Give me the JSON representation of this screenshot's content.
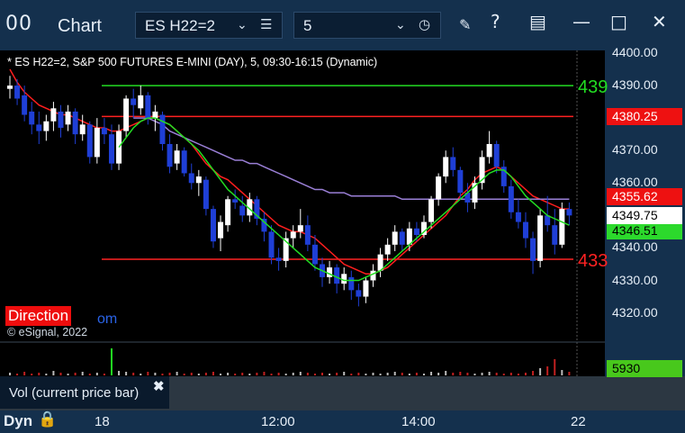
{
  "titlebar": {
    "icon": "00",
    "title": "Chart",
    "symbol": "ES H22=2",
    "interval": "5",
    "buttons": [
      "pencil-icon",
      "help-icon",
      "layout-icon",
      "minimize-icon",
      "maximize-icon",
      "close-icon"
    ]
  },
  "chart_title": "* ES H22=2, S&P 500 FUTURES E-MINI (DAY), 5, 09:30-16:15 (Dynamic)",
  "direction_label": "Direction",
  "direction_tail": "om",
  "copyright": "© eSignal, 2022",
  "vol_label": "Vol (current price bar)",
  "status": {
    "dyn": "Dyn"
  },
  "colors": {
    "up_candle": "#ffffff",
    "down_candle": "#1f3fd6",
    "red_line": "#ff1e1e",
    "green_line": "#22dd22",
    "purple_line": "#9a7fd6",
    "hline_red": "#ff2222",
    "hline_green": "#22dd22"
  },
  "chart_data": {
    "type": "candlestick",
    "symbol": "ES H22=2",
    "yrange": [
      4316,
      4400
    ],
    "y_ticks": [
      "4400.00",
      "4390.00",
      "4380.00",
      "4370.00",
      "4360.00",
      "4350.00",
      "4340.00",
      "4330.00",
      "4320.00"
    ],
    "x_ticks": [
      "18",
      "12:00",
      "14:00",
      "22"
    ],
    "horizontal_lines": [
      {
        "price": 4390,
        "color": "green",
        "label": "439"
      },
      {
        "price": 4380.5,
        "color": "red",
        "label": ""
      },
      {
        "price": 4336.5,
        "color": "red",
        "label": "433"
      }
    ],
    "price_tags": [
      {
        "price": 4380.25,
        "label": "4380.25",
        "style": "red"
      },
      {
        "price": 4355.62,
        "label": "4355.62",
        "style": "red"
      },
      {
        "price": 4349.75,
        "label": "4349.75",
        "style": "white"
      },
      {
        "price": 4346.51,
        "label": "4346.51",
        "style": "green"
      }
    ],
    "volume_tag": "5930",
    "candles": [
      {
        "o": 4389,
        "h": 4393,
        "l": 4386,
        "c": 4390
      },
      {
        "o": 4390,
        "h": 4392,
        "l": 4384,
        "c": 4386
      },
      {
        "o": 4387,
        "h": 4390,
        "l": 4379,
        "c": 4381
      },
      {
        "o": 4382,
        "h": 4385,
        "l": 4375,
        "c": 4378
      },
      {
        "o": 4378,
        "h": 4382,
        "l": 4372,
        "c": 4376
      },
      {
        "o": 4376,
        "h": 4381,
        "l": 4373,
        "c": 4379
      },
      {
        "o": 4379,
        "h": 4385,
        "l": 4376,
        "c": 4383
      },
      {
        "o": 4382,
        "h": 4384,
        "l": 4374,
        "c": 4377
      },
      {
        "o": 4378,
        "h": 4384,
        "l": 4376,
        "c": 4382
      },
      {
        "o": 4382,
        "h": 4383,
        "l": 4372,
        "c": 4375
      },
      {
        "o": 4375,
        "h": 4381,
        "l": 4373,
        "c": 4378
      },
      {
        "o": 4378,
        "h": 4379,
        "l": 4366,
        "c": 4368
      },
      {
        "o": 4368,
        "h": 4380,
        "l": 4366,
        "c": 4377
      },
      {
        "o": 4377,
        "h": 4380,
        "l": 4372,
        "c": 4375
      },
      {
        "o": 4375,
        "h": 4378,
        "l": 4364,
        "c": 4366
      },
      {
        "o": 4366,
        "h": 4378,
        "l": 4364,
        "c": 4376
      },
      {
        "o": 4376,
        "h": 4387,
        "l": 4374,
        "c": 4386
      },
      {
        "o": 4386,
        "h": 4389,
        "l": 4380,
        "c": 4384
      },
      {
        "o": 4383,
        "h": 4390,
        "l": 4381,
        "c": 4387
      },
      {
        "o": 4387,
        "h": 4388,
        "l": 4378,
        "c": 4380
      },
      {
        "o": 4380,
        "h": 4384,
        "l": 4376,
        "c": 4382
      },
      {
        "o": 4381,
        "h": 4382,
        "l": 4370,
        "c": 4372
      },
      {
        "o": 4372,
        "h": 4375,
        "l": 4363,
        "c": 4365
      },
      {
        "o": 4366,
        "h": 4372,
        "l": 4364,
        "c": 4370
      },
      {
        "o": 4370,
        "h": 4371,
        "l": 4362,
        "c": 4363
      },
      {
        "o": 4363,
        "h": 4366,
        "l": 4358,
        "c": 4360
      },
      {
        "o": 4360,
        "h": 4364,
        "l": 4356,
        "c": 4362
      },
      {
        "o": 4361,
        "h": 4362,
        "l": 4350,
        "c": 4352
      },
      {
        "o": 4352,
        "h": 4353,
        "l": 4340,
        "c": 4342
      },
      {
        "o": 4343,
        "h": 4350,
        "l": 4339,
        "c": 4348
      },
      {
        "o": 4347,
        "h": 4356,
        "l": 4345,
        "c": 4355
      },
      {
        "o": 4355,
        "h": 4358,
        "l": 4352,
        "c": 4354
      },
      {
        "o": 4353,
        "h": 4356,
        "l": 4348,
        "c": 4350
      },
      {
        "o": 4350,
        "h": 4357,
        "l": 4348,
        "c": 4355
      },
      {
        "o": 4355,
        "h": 4356,
        "l": 4347,
        "c": 4349
      },
      {
        "o": 4349,
        "h": 4351,
        "l": 4342,
        "c": 4345
      },
      {
        "o": 4345,
        "h": 4347,
        "l": 4335,
        "c": 4337
      },
      {
        "o": 4337,
        "h": 4340,
        "l": 4333,
        "c": 4336
      },
      {
        "o": 4336,
        "h": 4345,
        "l": 4334,
        "c": 4343
      },
      {
        "o": 4343,
        "h": 4347,
        "l": 4340,
        "c": 4345
      },
      {
        "o": 4345,
        "h": 4352,
        "l": 4343,
        "c": 4347
      },
      {
        "o": 4347,
        "h": 4350,
        "l": 4339,
        "c": 4341
      },
      {
        "o": 4341,
        "h": 4344,
        "l": 4333,
        "c": 4335
      },
      {
        "o": 4335,
        "h": 4337,
        "l": 4328,
        "c": 4331
      },
      {
        "o": 4331,
        "h": 4336,
        "l": 4329,
        "c": 4334
      },
      {
        "o": 4334,
        "h": 4335,
        "l": 4326,
        "c": 4329
      },
      {
        "o": 4329,
        "h": 4334,
        "l": 4327,
        "c": 4332
      },
      {
        "o": 4331,
        "h": 4333,
        "l": 4324,
        "c": 4327
      },
      {
        "o": 4327,
        "h": 4329,
        "l": 4322,
        "c": 4325
      },
      {
        "o": 4325,
        "h": 4331,
        "l": 4323,
        "c": 4330
      },
      {
        "o": 4330,
        "h": 4335,
        "l": 4328,
        "c": 4333
      },
      {
        "o": 4333,
        "h": 4340,
        "l": 4331,
        "c": 4338
      },
      {
        "o": 4338,
        "h": 4343,
        "l": 4336,
        "c": 4341
      },
      {
        "o": 4341,
        "h": 4347,
        "l": 4339,
        "c": 4345
      },
      {
        "o": 4345,
        "h": 4346,
        "l": 4339,
        "c": 4341
      },
      {
        "o": 4341,
        "h": 4348,
        "l": 4339,
        "c": 4346
      },
      {
        "o": 4346,
        "h": 4348,
        "l": 4342,
        "c": 4344
      },
      {
        "o": 4344,
        "h": 4350,
        "l": 4343,
        "c": 4348
      },
      {
        "o": 4348,
        "h": 4356,
        "l": 4346,
        "c": 4355
      },
      {
        "o": 4355,
        "h": 4363,
        "l": 4353,
        "c": 4362
      },
      {
        "o": 4362,
        "h": 4370,
        "l": 4360,
        "c": 4368
      },
      {
        "o": 4368,
        "h": 4371,
        "l": 4362,
        "c": 4364
      },
      {
        "o": 4364,
        "h": 4365,
        "l": 4355,
        "c": 4357
      },
      {
        "o": 4357,
        "h": 4360,
        "l": 4351,
        "c": 4354
      },
      {
        "o": 4354,
        "h": 4362,
        "l": 4352,
        "c": 4360
      },
      {
        "o": 4360,
        "h": 4370,
        "l": 4358,
        "c": 4368
      },
      {
        "o": 4368,
        "h": 4376,
        "l": 4366,
        "c": 4372
      },
      {
        "o": 4372,
        "h": 4373,
        "l": 4363,
        "c": 4365
      },
      {
        "o": 4365,
        "h": 4367,
        "l": 4357,
        "c": 4359
      },
      {
        "o": 4359,
        "h": 4361,
        "l": 4349,
        "c": 4351
      },
      {
        "o": 4351,
        "h": 4355,
        "l": 4346,
        "c": 4348
      },
      {
        "o": 4348,
        "h": 4351,
        "l": 4340,
        "c": 4343
      },
      {
        "o": 4343,
        "h": 4345,
        "l": 4332,
        "c": 4336
      },
      {
        "o": 4336,
        "h": 4352,
        "l": 4334,
        "c": 4350
      },
      {
        "o": 4350,
        "h": 4356,
        "l": 4345,
        "c": 4347
      },
      {
        "o": 4347,
        "h": 4352,
        "l": 4338,
        "c": 4341
      },
      {
        "o": 4341,
        "h": 4354,
        "l": 4340,
        "c": 4352
      },
      {
        "o": 4352,
        "h": 4354,
        "l": 4347,
        "c": 4350
      }
    ],
    "overlays": [
      {
        "color": "red",
        "values": [
          4395,
          4391,
          4388,
          4386,
          4384,
          4383,
          4382,
          4381,
          4381,
          4380,
          4379,
          4378,
          4377,
          4377,
          4376,
          4376,
          4377,
          4378,
          4379,
          4380,
          4380,
          4379,
          4378,
          4376,
          4374,
          4372,
          4369,
          4366,
          4364,
          4362,
          4361,
          4359,
          4357,
          4355,
          4353,
          4351,
          4349,
          4347,
          4346,
          4345,
          4345,
          4344,
          4343,
          4341,
          4339,
          4337,
          4335,
          4334,
          4333,
          4332,
          4332,
          4333,
          4334,
          4336,
          4338,
          4340,
          4342,
          4344,
          4346,
          4348,
          4350,
          4353,
          4356,
          4358,
          4361,
          4363,
          4364,
          4365,
          4364,
          4362,
          4360,
          4358,
          4356,
          4355,
          4354,
          4353,
          4352,
          4352
        ]
      },
      {
        "color": "purple",
        "values": [
          null,
          null,
          null,
          null,
          null,
          null,
          null,
          null,
          null,
          null,
          null,
          null,
          null,
          null,
          null,
          null,
          null,
          4380,
          4380,
          4380,
          4379,
          4378,
          4376,
          4375,
          4374,
          4373,
          4372,
          4371,
          4370,
          4369,
          4368,
          4367,
          4367,
          4366,
          4366,
          4365,
          4364,
          4363,
          4362,
          4361,
          4360,
          4359,
          4358,
          4358,
          4357,
          4357,
          4357,
          4356,
          4356,
          4356,
          4356,
          4356,
          4356,
          4356,
          4355,
          4355,
          4355,
          4355,
          4355,
          4355,
          4355,
          4355,
          4355,
          4355,
          4355,
          4355,
          4355,
          4355,
          4355,
          4355,
          4355,
          4355,
          4355,
          4355,
          4355,
          4355,
          4355,
          4355
        ]
      },
      {
        "color": "green",
        "values": [
          null,
          null,
          null,
          null,
          null,
          null,
          null,
          null,
          null,
          null,
          null,
          null,
          null,
          null,
          null,
          4371,
          4374,
          4377,
          4379,
          4380,
          4380,
          4379,
          4378,
          4376,
          4374,
          4372,
          4370,
          4367,
          4364,
          4361,
          4358,
          4356,
          4354,
          4352,
          4350,
          4348,
          4346,
          4344,
          4342,
          4340,
          4338,
          4336,
          4334,
          4333,
          4332,
          4331,
          4330,
          4330,
          4330,
          4331,
          4332,
          4333,
          4335,
          4337,
          4339,
          4341,
          4343,
          4345,
          4347,
          4349,
          4351,
          4353,
          4355,
          4357,
          4359,
          4361,
          4363,
          4364,
          4364,
          4362,
          4359,
          4356,
          4354,
          4352,
          4350,
          4349,
          4348,
          4347
        ]
      }
    ],
    "volume": [
      3,
      2,
      4,
      2,
      3,
      2,
      5,
      3,
      2,
      3,
      4,
      2,
      3,
      2,
      30,
      5,
      4,
      3,
      2,
      4,
      3,
      2,
      3,
      4,
      2,
      3,
      2,
      3,
      4,
      2,
      3,
      2,
      3,
      2,
      3,
      4,
      2,
      3,
      2,
      3,
      4,
      3,
      2,
      3,
      2,
      3,
      4,
      2,
      3,
      2,
      3,
      2,
      3,
      4,
      3,
      2,
      3,
      2,
      4,
      3,
      5,
      3,
      4,
      3,
      2,
      3,
      4,
      3,
      2,
      3,
      2,
      3,
      5,
      8,
      10,
      18,
      6,
      4
    ]
  }
}
